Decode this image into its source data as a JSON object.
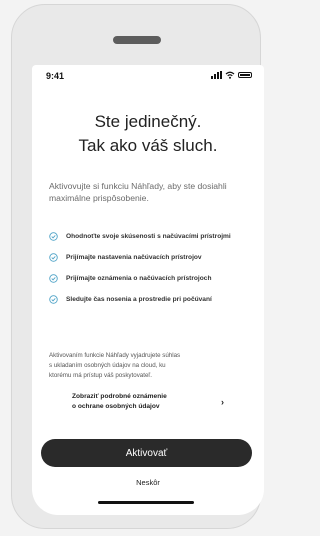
{
  "status_bar": {
    "time": "9:41"
  },
  "heading": {
    "line1": "Ste jedinečný.",
    "line2": "Tak ako váš sluch."
  },
  "subtitle": "Aktivovujte si funkciu Náhľady, aby ste dosiahli maximálne prispôsobenie.",
  "features": [
    {
      "label": "Ohodnoťte svoje skúsenosti s načúvacími prístrojmi",
      "icon": "check-circle-icon"
    },
    {
      "label": "Prijímajte nastavenia načúvacích prístrojov",
      "icon": "check-circle-icon"
    },
    {
      "label": "Prijímajte oznámenia o načúvacích prístrojoch",
      "icon": "check-circle-icon"
    },
    {
      "label": "Sledujte čas nosenia a prostredie pri počúvaní",
      "icon": "check-circle-icon"
    }
  ],
  "consent": {
    "line1": "Aktivovaním funkcie Náhľady vyjadrujete súhlas",
    "line2": "s ukladaním osobných údajov na cloud, ku",
    "line3": "ktorému má prístup váš poskytovateľ."
  },
  "privacy_link": {
    "line1": "Zobraziť podrobné oznámenie",
    "line2": "o ochrane osobných údajov",
    "icon": "chevron-right-icon"
  },
  "buttons": {
    "activate": "Aktivovať",
    "later": "Neskôr"
  },
  "colors": {
    "accent": "#4fa3c7",
    "primary_button": "#2a2a2a",
    "background": "#f3f3f3"
  }
}
